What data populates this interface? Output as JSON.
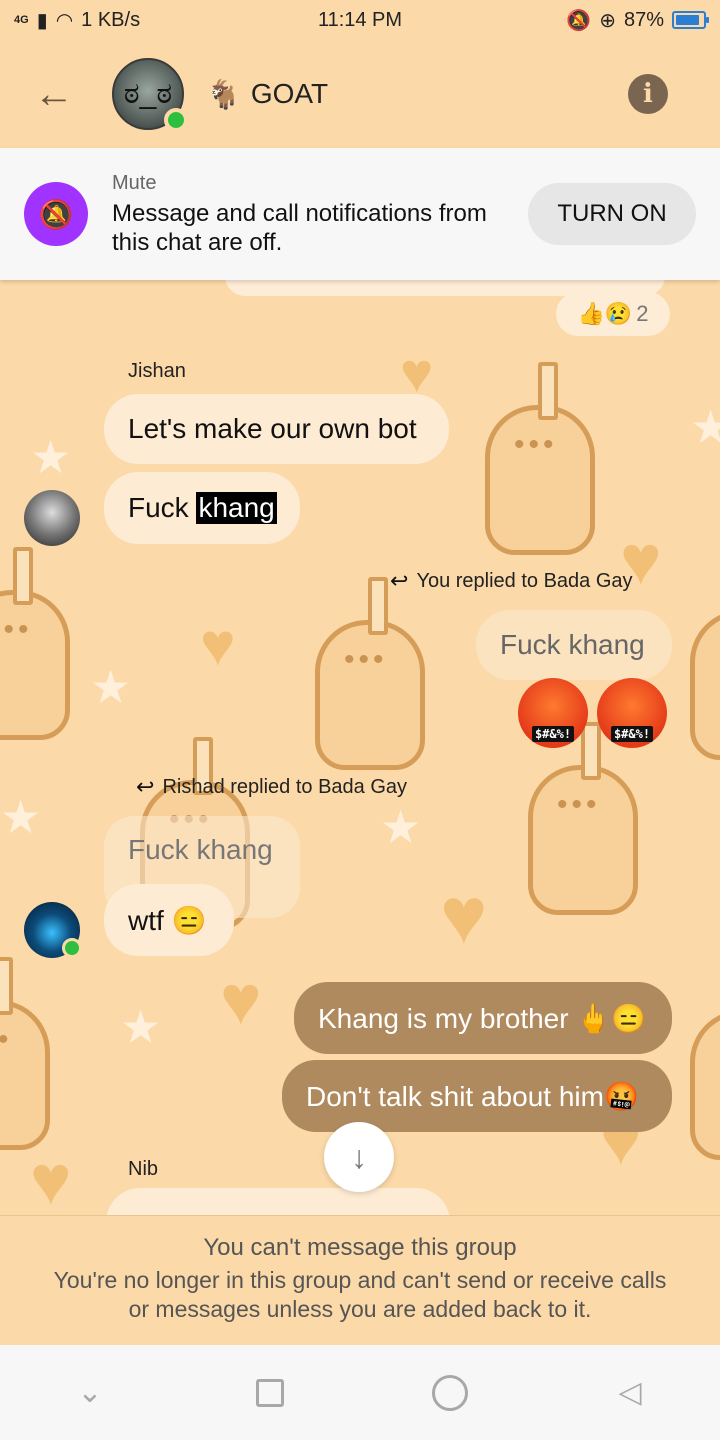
{
  "status_bar": {
    "network": "4G",
    "speed": "1 KB/s",
    "time": "11:14 PM",
    "battery": "87%",
    "battery_level": 0.87
  },
  "header": {
    "title": "GOAT",
    "title_emoji": "🐐",
    "back_icon": "arrow-left-icon",
    "info_icon": "info-icon"
  },
  "mute_banner": {
    "label": "Mute",
    "description": "Message and call notifications from this chat are off.",
    "button": "TURN ON",
    "icon": "bell-off-icon"
  },
  "chat": {
    "top_reaction": {
      "emojis": "👍😢",
      "count": "2"
    },
    "messages": [
      {
        "sender": "Jishan",
        "text": "Let's make our own bot"
      },
      {
        "text_pre": "Fuck ",
        "text_highlight": "khang"
      },
      {
        "reply_note": "You replied to Bada Gay",
        "quoted": "Fuck khang",
        "stickers": [
          "$#&%!",
          "$#&%!"
        ]
      },
      {
        "reply_note": "Rishad replied to Bada Gay",
        "quoted": "Fuck khang",
        "text": "wtf 😑"
      },
      {
        "text": "Khang is my brother 🖕😑"
      },
      {
        "text": "Don't talk shit about him🤬"
      },
      {
        "sender": "Nib"
      }
    ]
  },
  "footer": {
    "title": "You can't message this group",
    "description": "You're no longer in this group and can't send or receive calls or messages unless you are added back to it."
  },
  "accent_colors": {
    "background": "#fbd9a8",
    "mute_icon": "#a033ff",
    "outgoing_bubble": "#b08a5f",
    "online": "#2fbf3f"
  }
}
